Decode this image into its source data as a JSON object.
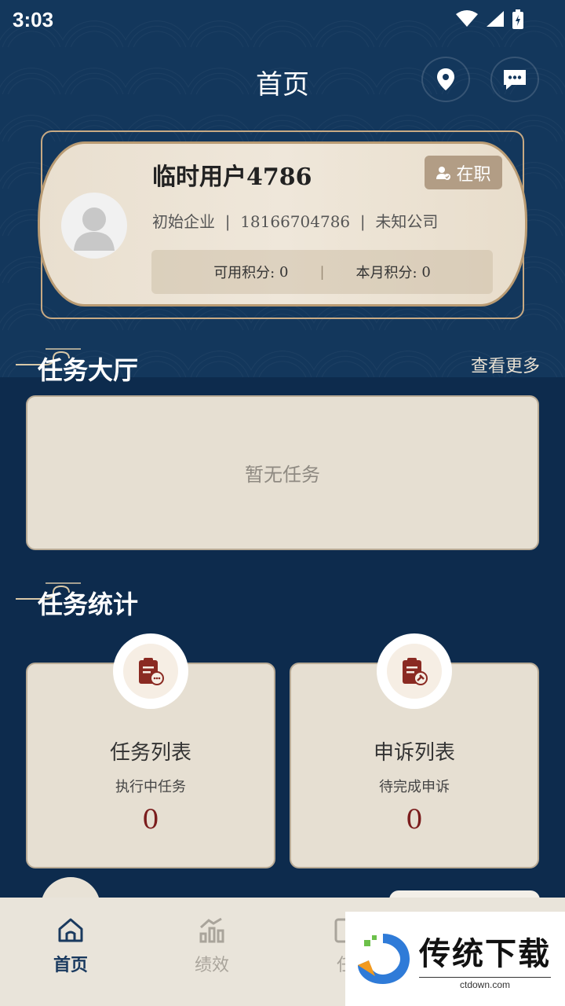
{
  "status_bar": {
    "time": "3:03"
  },
  "header": {
    "title": "首页"
  },
  "profile": {
    "name": "临时用户4786",
    "status": "在职",
    "company": "初始企业",
    "phone": "18166704786",
    "org": "未知公司",
    "sep": "|",
    "available_points_label": "可用积分:",
    "available_points": "0",
    "month_points_label": "本月积分:",
    "month_points": "0"
  },
  "task_hall": {
    "title": "任务大厅",
    "see_more": "查看更多",
    "empty": "暂无任务"
  },
  "task_stats": {
    "title": "任务统计",
    "cards": [
      {
        "title": "任务列表",
        "subtitle": "执行中任务",
        "count": "0"
      },
      {
        "title": "申诉列表",
        "subtitle": "待完成申诉",
        "count": "0"
      }
    ]
  },
  "tabbar": {
    "items": [
      {
        "label": "首页",
        "icon": "home-icon"
      },
      {
        "label": "绩效",
        "icon": "chart-icon"
      },
      {
        "label": "任",
        "icon": "task-icon"
      }
    ]
  },
  "watermark": {
    "title": "传统下载",
    "url": "ctdown.com"
  },
  "colors": {
    "navy": "#0d2b4d",
    "card": "#e6dfd2",
    "accent_red": "#7b1d1d",
    "gold": "#b99b73"
  }
}
